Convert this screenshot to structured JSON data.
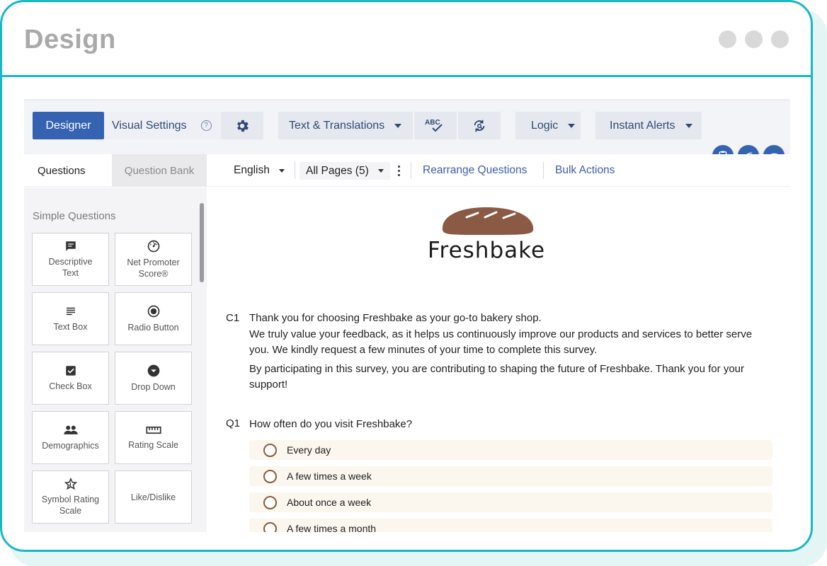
{
  "window": {
    "title": "Design"
  },
  "toolbar": {
    "designer": "Designer",
    "visual_settings": "Visual Settings",
    "help": "?",
    "text_translations": "Text & Translations",
    "logic": "Logic",
    "instant_alerts": "Instant Alerts"
  },
  "subbar": {
    "tab_questions": "Questions",
    "tab_question_bank": "Question Bank",
    "language": "English",
    "pages": "All Pages (5)",
    "rearrange": "Rearrange Questions",
    "bulk_actions": "Bulk Actions"
  },
  "sidebar": {
    "section_title": "Simple Questions",
    "tiles": [
      {
        "label": "Descriptive Text",
        "icon": "comment-icon"
      },
      {
        "label": "Net Promoter Score®",
        "icon": "gauge-icon"
      },
      {
        "label": "Text Box",
        "icon": "text-lines-icon"
      },
      {
        "label": "Radio Button",
        "icon": "radio-icon"
      },
      {
        "label": "Check Box",
        "icon": "checkbox-icon"
      },
      {
        "label": "Drop Down",
        "icon": "dropdown-icon"
      },
      {
        "label": "Demographics",
        "icon": "people-icon"
      },
      {
        "label": "Rating Scale",
        "icon": "ruler-icon"
      },
      {
        "label": "Symbol Rating Scale",
        "icon": "star-icon"
      },
      {
        "label": "Like/Dislike",
        "icon": ""
      }
    ]
  },
  "survey": {
    "logo_text": "Freshbake",
    "c1": {
      "number": "C1",
      "lines": [
        "Thank you for choosing Freshbake as your go-to bakery shop.",
        "We truly value your feedback, as it helps us continuously improve our products and services to better serve you.  We kindly request a few minutes of your time to complete this survey.",
        "By participating in this survey, you are contributing to shaping the future of Freshbake. Thank you for your support!"
      ]
    },
    "q1": {
      "number": "Q1",
      "text": "How often do you visit Freshbake?",
      "options": [
        "Every day",
        "A few times a week",
        "About once a week",
        "A few times a month"
      ]
    }
  },
  "colors": {
    "frame": "#18b8c4",
    "primary": "#3563b2",
    "link": "#3e5ea8",
    "radio": "#8a5a3c",
    "option_bg": "#fbf6ee",
    "bread": "#8b5a44"
  }
}
